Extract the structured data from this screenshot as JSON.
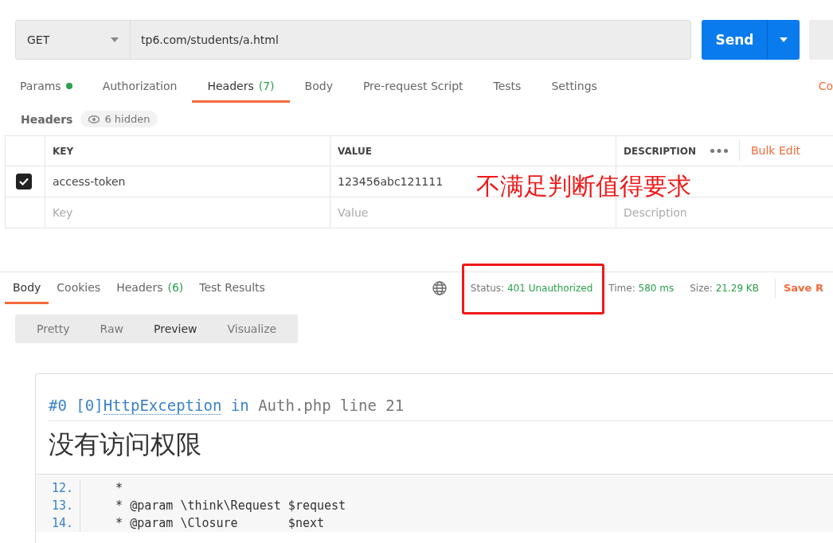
{
  "request": {
    "method": "GET",
    "url": "tp6.com/students/a.html",
    "send": "Send"
  },
  "request_tabs": [
    {
      "label": "Params",
      "dot": true,
      "selected": false
    },
    {
      "label": "Authorization",
      "dot": false,
      "selected": false
    },
    {
      "label": "Headers",
      "count": "(7)",
      "dot": false,
      "selected": true
    },
    {
      "label": "Body",
      "dot": false,
      "selected": false
    },
    {
      "label": "Pre-request Script",
      "dot": false,
      "selected": false
    },
    {
      "label": "Tests",
      "dot": false,
      "selected": false
    },
    {
      "label": "Settings",
      "dot": false,
      "selected": false
    }
  ],
  "cookies_link": "Co",
  "headers_bar": {
    "title": "Headers",
    "hidden": "6 hidden"
  },
  "headers_table": {
    "columns": [
      "KEY",
      "VALUE",
      "DESCRIPTION"
    ],
    "bulk_edit": "Bulk Edit",
    "rows": [
      {
        "key": "access-token",
        "value": "123456abc121111",
        "checked": true
      }
    ],
    "placeholders": {
      "key": "Key",
      "value": "Value",
      "description": "Description"
    }
  },
  "annotation": {
    "text": "不满足判断值得要求"
  },
  "response_tabs": [
    {
      "label": "Body",
      "selected": true
    },
    {
      "label": "Cookies",
      "selected": false
    },
    {
      "label": "Headers",
      "count": "(6)",
      "selected": false
    },
    {
      "label": "Test Results",
      "selected": false
    }
  ],
  "response_meta": [
    {
      "label": "Status:",
      "value": "401 Unauthorized"
    },
    {
      "label": "Time:",
      "value": "580 ms"
    },
    {
      "label": "Size:",
      "value": "21.29 KB"
    }
  ],
  "save_link": "Save R",
  "view_modes": [
    {
      "label": "Pretty",
      "selected": false
    },
    {
      "label": "Raw",
      "selected": false
    },
    {
      "label": "Preview",
      "selected": true
    },
    {
      "label": "Visualize",
      "selected": false
    }
  ],
  "preview": {
    "prefix": "#0 [0]",
    "exception": "HttpException",
    "in": "in",
    "location": "Auth.php line 21",
    "message": "没有访问权限",
    "code": [
      {
        "num": "12.",
        "text": "    *"
      },
      {
        "num": "13.",
        "text": "    * @param \\think\\Request $request"
      },
      {
        "num": "14.",
        "text": "    * @param \\Closure       $next"
      }
    ]
  }
}
